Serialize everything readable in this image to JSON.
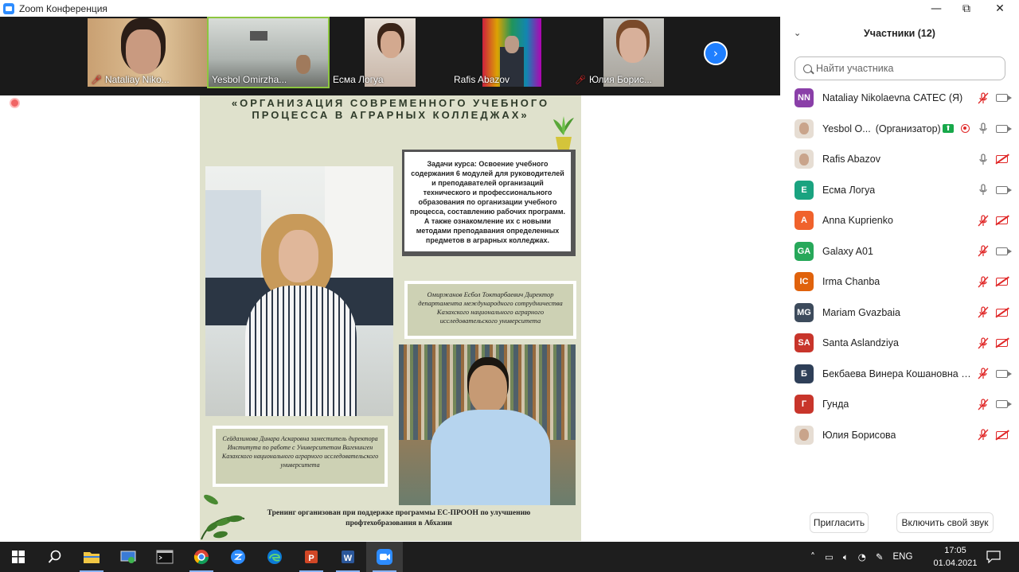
{
  "window": {
    "title": "Zoom Конференция",
    "controls": {
      "minimize": "—",
      "restore": "⧉",
      "close": "✕"
    }
  },
  "video_strip": {
    "tiles": [
      {
        "name": "Nataliay Niko...",
        "muted": true,
        "active": false
      },
      {
        "name": "Yesbol Omirzha...",
        "muted": false,
        "active": true
      },
      {
        "name": "Есма Логуа",
        "muted": false,
        "active": false
      },
      {
        "name": "Rafis Abazov",
        "muted": false,
        "active": false
      },
      {
        "name": "Юлия Борис...",
        "muted": true,
        "active": false
      }
    ],
    "next_icon": "chevron-right-icon"
  },
  "slide": {
    "title_line1": "«ОРГАНИЗАЦИЯ СОВРЕМЕННОГО УЧЕБНОГО",
    "title_line2": "ПРОЦЕССА В АГРАРНЫХ КОЛЛЕДЖАХ»",
    "info_text": "Задачи курса: Освоение учебного содержания 6 модулей для руководителей и преподавателей организаций технического и профессионального образования по организации учебного процесса, составлению рабочих программ. А также ознакомление их с новыми методами преподавания определенных предметов в аграрных колледжах.",
    "caption_right": "Омиржанов Есбол Токтарбаевич Директор департамента международного сотрудничества Казахского национального аграрного исследовательского университета",
    "caption_left": "Сейдазимова Динара Аскаровна заместитель директора Института по работе с Университетом Вагенинген Казахского национального аграрного исследовательского университета",
    "footer": "Тренинг организован при поддержке программы ЕС-ПРООН по улучшению профтехобразования в Абхазии"
  },
  "participants_panel": {
    "title": "Участники (12)",
    "search_placeholder": "Найти участника",
    "participants": [
      {
        "initials": "NN",
        "color": "#8a3fa8",
        "name": "Nataliay Nikolaevna CATEC (Я)",
        "role": "",
        "mic": "off",
        "cam": "on"
      },
      {
        "initials": "",
        "color": "",
        "name": "Yesbol O...",
        "role": "(Организатор)",
        "mic": "on",
        "cam": "on",
        "host": true
      },
      {
        "initials": "",
        "color": "",
        "name": "Rafis Abazov",
        "role": "",
        "mic": "on",
        "cam": "off"
      },
      {
        "initials": "Е",
        "color": "#1aa380",
        "name": "Есма Логуа",
        "role": "",
        "mic": "on",
        "cam": "on"
      },
      {
        "initials": "A",
        "color": "#f0622c",
        "name": "Anna Kuprienko",
        "role": "",
        "mic": "off",
        "cam": "off"
      },
      {
        "initials": "GA",
        "color": "#27a85a",
        "name": "Galaxy A01",
        "role": "",
        "mic": "off",
        "cam": "on"
      },
      {
        "initials": "IC",
        "color": "#e0620c",
        "name": "Irma Chanba",
        "role": "",
        "mic": "off",
        "cam": "off"
      },
      {
        "initials": "MG",
        "color": "#3d4b5c",
        "name": "Mariam Gvazbaia",
        "role": "",
        "mic": "off",
        "cam": "off"
      },
      {
        "initials": "SA",
        "color": "#c8352b",
        "name": "Santa Aslandziya",
        "role": "",
        "mic": "off",
        "cam": "off"
      },
      {
        "initials": "Б",
        "color": "#2e3f58",
        "name": "Бекбаева Винера Кошановна Е...",
        "role": "",
        "mic": "off",
        "cam": "on"
      },
      {
        "initials": "Г",
        "color": "#c8352b",
        "name": "Гунда",
        "role": "",
        "mic": "off",
        "cam": "on"
      },
      {
        "initials": "",
        "color": "",
        "name": "Юлия Борисова",
        "role": "",
        "mic": "off",
        "cam": "off"
      }
    ],
    "invite_label": "Пригласить",
    "unmute_label": "Включить свой звук"
  },
  "taskbar": {
    "apps": [
      "start-icon",
      "search-icon",
      "file-explorer-icon",
      "control-panel-icon",
      "terminal-icon",
      "chrome-icon",
      "zoom-icon-blue",
      "edge-icon",
      "powerpoint-icon",
      "word-icon",
      "zoom-icon"
    ],
    "language": "ENG",
    "time": "17:05",
    "date": "01.04.2021"
  }
}
